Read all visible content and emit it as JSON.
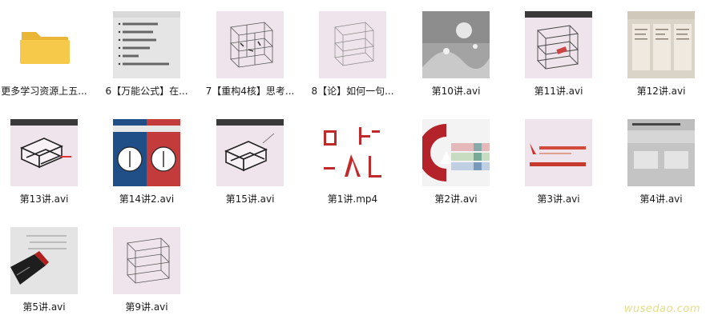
{
  "files": [
    {
      "name": "更多学习资源上五...",
      "type": "folder",
      "icon": "folder-icon"
    },
    {
      "name": "6【万能公式】在...",
      "type": "video",
      "thumb": "slide-list"
    },
    {
      "name": "7【重构4核】思考...",
      "type": "video",
      "thumb": "cube-sketch"
    },
    {
      "name": "8【论】如何一句...",
      "type": "video",
      "thumb": "cube-sketch-light"
    },
    {
      "name": "第10讲.avi",
      "type": "video",
      "thumb": "gray-splash"
    },
    {
      "name": "第11讲.avi",
      "type": "video",
      "thumb": "cube-sketch-banner"
    },
    {
      "name": "第12讲.avi",
      "type": "video",
      "thumb": "paper-docs"
    },
    {
      "name": "第13讲.avi",
      "type": "video",
      "thumb": "books-sketch"
    },
    {
      "name": "第14讲2.avi",
      "type": "video",
      "thumb": "two-clocks"
    },
    {
      "name": "第15讲.avi",
      "type": "video",
      "thumb": "books-sketch-2"
    },
    {
      "name": "第1讲.mp4",
      "type": "video",
      "thumb": "chinese-characters"
    },
    {
      "name": "第2讲.avi",
      "type": "video",
      "thumb": "red-c-logo"
    },
    {
      "name": "第3讲.avi",
      "type": "video",
      "thumb": "title-card"
    },
    {
      "name": "第4讲.avi",
      "type": "video",
      "thumb": "gray-doc"
    },
    {
      "name": "第5讲.avi",
      "type": "video",
      "thumb": "pen-closeup"
    },
    {
      "name": "第9讲.avi",
      "type": "video",
      "thumb": "cube-sketch"
    }
  ],
  "watermark": "wusedao.com",
  "colors": {
    "folder": "#f6c94a",
    "thumb_bg": "#efe4eb",
    "clock_blue": "#1f4f86",
    "clock_red": "#c43b3b",
    "logo_red": "#b4232a",
    "watermark": "#e3e08a"
  }
}
